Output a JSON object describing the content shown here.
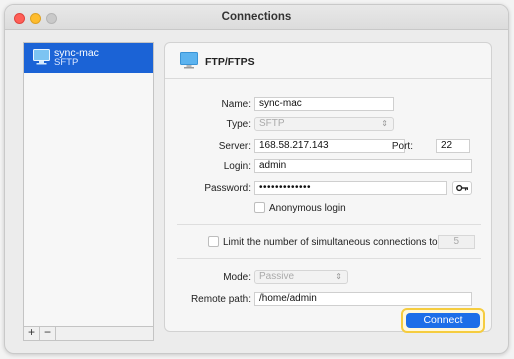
{
  "window": {
    "title": "Connections"
  },
  "sidebar": {
    "items": [
      {
        "name": "sync-mac",
        "protocol": "SFTP"
      }
    ],
    "add_label": "+",
    "remove_label": "−"
  },
  "panel": {
    "title": "FTP/FTPS",
    "name_label": "Name:",
    "name_value": "sync-mac",
    "type_label": "Type:",
    "type_value": "SFTP",
    "server_label": "Server:",
    "server_value": "168.58.217.143",
    "port_label": "Port:",
    "port_value": "22",
    "login_label": "Login:",
    "login_value": "admin",
    "password_label": "Password:",
    "password_value": "•••••••••••••",
    "anonymous_label": "Anonymous login",
    "limit_label": "Limit the number of simultaneous connections to",
    "limit_value": "5",
    "mode_label": "Mode:",
    "mode_value": "Passive",
    "remote_path_label": "Remote path:",
    "remote_path_value": "/home/admin",
    "connect_label": "Connect"
  },
  "colors": {
    "accent": "#1b63d6",
    "button": "#1d6ee8",
    "highlight": "#f5cc3f"
  },
  "icons": {
    "connection": "monitor-icon",
    "key": "key-icon"
  }
}
